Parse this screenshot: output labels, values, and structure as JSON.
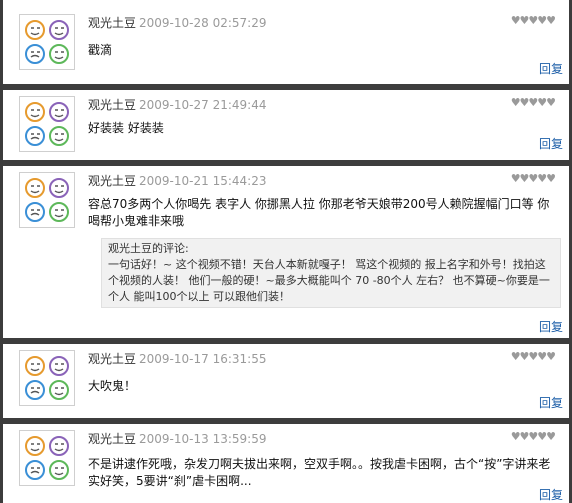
{
  "colors": {
    "background": "#ffffff",
    "separator": "#3d3d3d",
    "link": "#1e5fa8",
    "date": "#9a9a9a"
  },
  "avatar_icon": "four-faces-avatar-icon",
  "reply_label": "回复",
  "rating_icons": "heart-rating-icons",
  "comments": [
    {
      "author": "观光土豆",
      "date": "2009-10-28 02:57:29",
      "text": "戳滴"
    },
    {
      "author": "观光土豆",
      "date": "2009-10-27 21:49:44",
      "text": "好装装 好装装"
    },
    {
      "author": "观光土豆",
      "date": "2009-10-21 15:44:23",
      "text": "容总70多两个人你喝先 表字人 你挪黑人拉 你那老爷天娘带200号人赖院握幅门口等 你喝帮小鬼难非来哦",
      "quote_title": "观光土豆的评论:",
      "quote_text": "一句话好！~ 这个视频不错！天台人本新就嘎子！ 骂这个视频的 报上名字和外号！找拍这个视频的人装！ 他们一般的硬！~最多大概能叫个 70 -80个人 左右？ 也不算硬~你要是一个人 能叫100个以上 可以跟他们装！"
    },
    {
      "author": "观光土豆",
      "date": "2009-10-17 16:31:55",
      "text": "大吹鬼！"
    },
    {
      "author": "观光土豆",
      "date": "2009-10-13 13:59:59",
      "text": "不是讲逮作死哦，杂发刀啊夫拔出来啊，空双手啊。。按我虐卡困啊，古个“按”字讲来老实好笑，5要讲“刹”虐卡困啊..."
    }
  ]
}
